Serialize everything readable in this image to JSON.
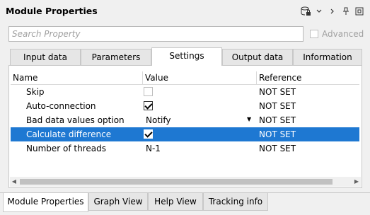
{
  "title": "Module Properties",
  "toolbar_icons": [
    "database-lock-icon",
    "chevron-down-icon",
    "chevron-right-icon",
    "pin-icon",
    "restore-icon"
  ],
  "search": {
    "placeholder": "Search Property",
    "value": ""
  },
  "advanced": {
    "label": "Advanced",
    "checked": false
  },
  "tabs": [
    {
      "label": "Input data",
      "active": false
    },
    {
      "label": "Parameters",
      "active": false
    },
    {
      "label": "Settings",
      "active": true
    },
    {
      "label": "Output data",
      "active": false
    },
    {
      "label": "Information",
      "active": false
    }
  ],
  "grid": {
    "columns": [
      "Name",
      "Value",
      "Reference"
    ],
    "rows": [
      {
        "name": "Skip",
        "value_type": "checkbox",
        "checked": false,
        "reference": "NOT SET",
        "selected": false
      },
      {
        "name": "Auto-connection",
        "value_type": "checkbox",
        "checked": true,
        "reference": "NOT SET",
        "selected": false
      },
      {
        "name": "Bad data values option",
        "value_type": "dropdown",
        "value": "Notify",
        "reference": "NOT SET",
        "selected": false
      },
      {
        "name": "Calculate difference",
        "value_type": "checkbox",
        "checked": true,
        "reference": "NOT SET",
        "selected": true
      },
      {
        "name": "Number of threads",
        "value_type": "text",
        "value": "N-1",
        "reference": "NOT SET",
        "selected": false
      }
    ]
  },
  "bottom_tabs": [
    {
      "label": "Module Properties",
      "active": true
    },
    {
      "label": "Graph View",
      "active": false
    },
    {
      "label": "Help View",
      "active": false
    },
    {
      "label": "Tracking info",
      "active": false
    }
  ],
  "colors": {
    "selection": "#1e78d2",
    "background": "#f0f0f0"
  }
}
